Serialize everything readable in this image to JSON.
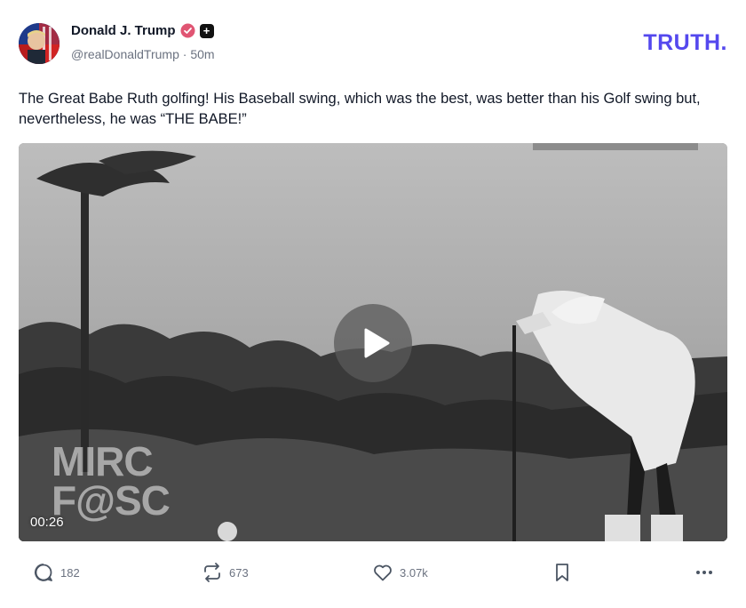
{
  "author": {
    "display_name": "Donald J. Trump",
    "handle": "@realDonaldTrump",
    "separator": "·",
    "time_ago": "50m"
  },
  "brand": {
    "logo_text": "TRUTH",
    "logo_dot": "."
  },
  "post": {
    "text": "The Great Babe Ruth golfing! His Baseball swing, which was the best, was better than his Golf swing but, nevertheless, he was “THE BABE!”"
  },
  "video": {
    "duration": "00:26",
    "watermark_line1": "MIRC",
    "watermark_line2": "F@SC"
  },
  "actions": {
    "replies": "182",
    "retruths": "673",
    "likes": "3.07k"
  },
  "colors": {
    "brand": "#5448ee",
    "verified": "#e05573",
    "muted": "#6b7280"
  },
  "icons": [
    "verified-badge-icon",
    "plus-badge-icon",
    "play-icon",
    "reply-icon",
    "retruth-icon",
    "like-icon",
    "bookmark-icon",
    "more-icon"
  ]
}
